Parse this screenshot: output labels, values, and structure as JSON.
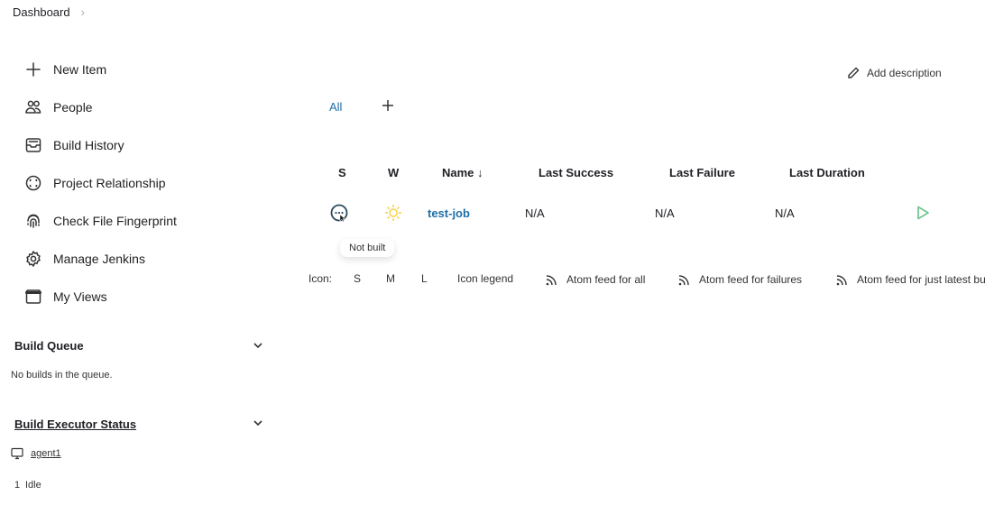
{
  "breadcrumb": {
    "items": [
      "Dashboard"
    ]
  },
  "sidebar": {
    "tasks": [
      {
        "label": "New Item",
        "icon": "plus-icon"
      },
      {
        "label": "People",
        "icon": "people-icon"
      },
      {
        "label": "Build History",
        "icon": "inbox-icon"
      },
      {
        "label": "Project Relationship",
        "icon": "relationship-icon"
      },
      {
        "label": "Check File Fingerprint",
        "icon": "fingerprint-icon"
      },
      {
        "label": "Manage Jenkins",
        "icon": "gear-icon"
      },
      {
        "label": "My Views",
        "icon": "window-icon"
      }
    ],
    "build_queue": {
      "title": "Build Queue",
      "empty_text": "No builds in the queue."
    },
    "executor_status": {
      "title": "Build Executor Status",
      "agent": "agent1",
      "executors": [
        {
          "number": "1",
          "state": "Idle"
        }
      ]
    }
  },
  "main": {
    "add_description": "Add description",
    "tabs": [
      {
        "label": "All",
        "active": true
      }
    ],
    "add_tab_icon": "plus-icon",
    "table": {
      "columns": [
        "S",
        "W",
        "Name ↓",
        "Last Success",
        "Last Failure",
        "Last Duration"
      ],
      "rows": [
        {
          "status": "not-built",
          "weather": "sunny",
          "name": "test-job",
          "last_success": "N/A",
          "last_failure": "N/A",
          "last_duration": "N/A"
        }
      ]
    },
    "tooltip": "Not built",
    "icon_size": {
      "label": "Icon:",
      "options": [
        "S",
        "M",
        "L"
      ]
    },
    "icon_legend": "Icon legend",
    "feeds": [
      "Atom feed for all",
      "Atom feed for failures",
      "Atom feed for just latest builds"
    ]
  },
  "colors": {
    "link": "#1e6fa8",
    "build_green": "#6fc48c",
    "sun": "#f4d03f",
    "status_ring": "#2b4a5c"
  }
}
